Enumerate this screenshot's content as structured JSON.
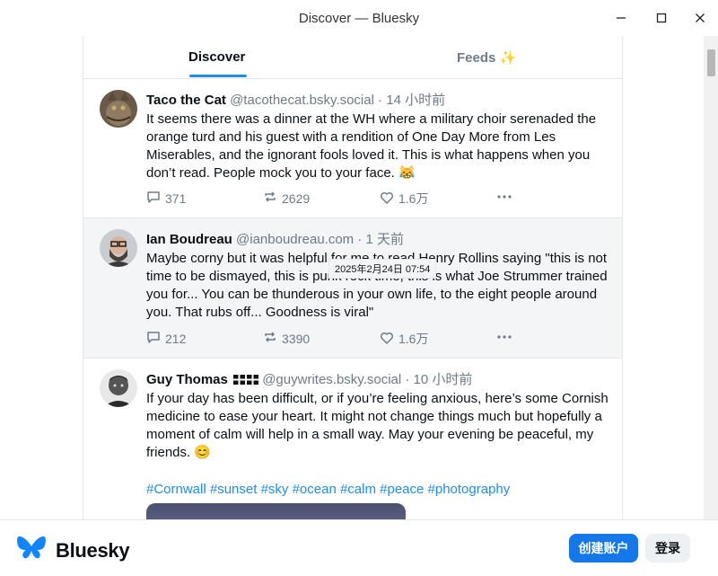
{
  "window": {
    "title": "Discover — Bluesky",
    "controls": [
      "minimize-icon",
      "maximize-icon",
      "close-icon"
    ]
  },
  "tabs": {
    "discover": "Discover",
    "feeds": "Feeds ✨"
  },
  "posts": [
    {
      "name": "Taco the Cat",
      "handle": "@tacothecat.bsky.social",
      "time": "14 小时前",
      "text": "It seems there was a dinner at the WH where a military choir serenaded the orange turd and his guest with a rendition of One Day More from Les Miserables, and the ignorant fools loved it. This is what happens when you don’t read. People mock you to your face. 😹",
      "replies": "371",
      "reposts": "2629",
      "likes": "1.6万"
    },
    {
      "name": "Ian Boudreau",
      "handle": "@ianboudreau.com",
      "time": "1 天前",
      "text": "Maybe corny but it was helpful for me to read Henry Rollins saying \"this is not time to be dismayed, this is punk rock time, this is what Joe Strummer trained you for... You can be thunderous in your own life, to the eight people around you. That rubs off... Goodness is viral\"",
      "replies": "212",
      "reposts": "3390",
      "likes": "1.6万",
      "tooltip": "2025年2月24日 07:54"
    },
    {
      "name": "Guy Thomas",
      "flag": "cornwall-flag",
      "handle": "@guywrites.bsky.social",
      "time": "10 小时前",
      "text": "If your day has been difficult, or if you’re feeling anxious, here’s some Cornish medicine to ease your heart. It might not change things much but hopefully a moment of calm will help in a small way. May your evening be peaceful, my friends. 😊",
      "hashtags": "#Cornwall #sunset #sky #ocean #calm #peace #photography"
    }
  ],
  "footer": {
    "brand": "Bluesky",
    "create_account": "创建账户",
    "login": "登录"
  },
  "colors": {
    "accent": "#1d8cf0",
    "button": "#1577e8",
    "muted": "#6e7a89"
  }
}
